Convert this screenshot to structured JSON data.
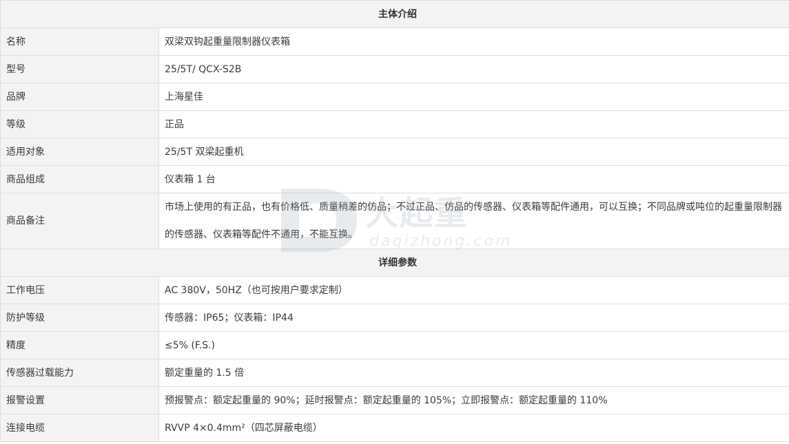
{
  "sections": [
    {
      "title": "主体介绍",
      "rows": [
        {
          "label": "名称",
          "value": "双梁双钩起重量限制器仪表箱"
        },
        {
          "label": "型号",
          "value": "25/5T/ QCX-S2B"
        },
        {
          "label": "品牌",
          "value": "上海星佳"
        },
        {
          "label": "等级",
          "value": "正品"
        },
        {
          "label": "适用对象",
          "value": "25/5T 双梁起重机"
        },
        {
          "label": "商品组成",
          "value": "仪表箱 1 台"
        },
        {
          "label": "商品备注",
          "value": "市场上使用的有正品，也有价格低、质量稍差的仿品；不过正品、仿品的传感器、仪表箱等配件通用，可以互换；不同品牌或吨位的起重量限制器的传感器、仪表箱等配件不通用，不能互换。"
        }
      ]
    },
    {
      "title": "详细参数",
      "rows": [
        {
          "label": "工作电压",
          "value": "AC 380V，50HZ（也可按用户要求定制）"
        },
        {
          "label": "防护等级",
          "value": "传感器：IP65；仪表箱：IP44"
        },
        {
          "label": "精度",
          "value": "≤5% (F.S.)"
        },
        {
          "label": "传感器过载能力",
          "value": "额定重量的 1.5 倍"
        },
        {
          "label": "报警设置",
          "value": "预报警点：额定起重量的 90%；延时报警点：额定起重量的 105%；立即报警点：额定起重量的 110%"
        },
        {
          "label": "连接电缆",
          "value": "RVVP 4×0.4mm²（四芯屏蔽电缆）"
        }
      ]
    }
  ],
  "watermark": {
    "brand_cn": "大起重",
    "brand_en": "daqizhong.com"
  },
  "colors": {
    "header_bg": "#f3f3f3",
    "label_bg": "#f3f3f3",
    "border": "#dedede",
    "text": "#3a3a3a"
  }
}
